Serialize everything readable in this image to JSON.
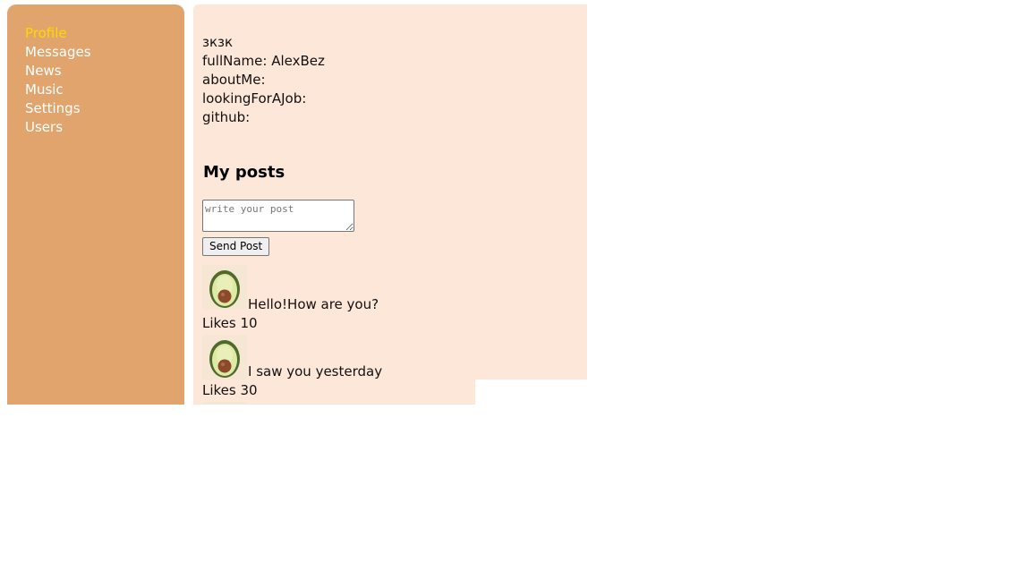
{
  "nav": {
    "items": [
      {
        "label": "Profile",
        "active": true
      },
      {
        "label": "Messages",
        "active": false
      },
      {
        "label": "News",
        "active": false
      },
      {
        "label": "Music",
        "active": false
      },
      {
        "label": "Settings",
        "active": false
      },
      {
        "label": "Users",
        "active": false
      }
    ]
  },
  "profile": {
    "status": "зкзк",
    "full_name": "fullName: AlexBez",
    "about_me": "aboutMe:",
    "looking_for_a_job": "lookingForAJob:",
    "github": "github:"
  },
  "posts": {
    "title": "My posts",
    "textarea_placeholder": "write your post",
    "send_label": "Send Post",
    "items": [
      {
        "avatar": "avocado-icon",
        "message": "Hello!How are you?",
        "likes": "Likes 10"
      },
      {
        "avatar": "avocado-icon",
        "message": "I saw you yesterday",
        "likes": "Likes 30"
      }
    ]
  },
  "colors": {
    "nav_bg": "#e2a46d",
    "nav_text": "#ffffff",
    "nav_active": "#ffd700",
    "content_bg": "#fde7d8"
  }
}
